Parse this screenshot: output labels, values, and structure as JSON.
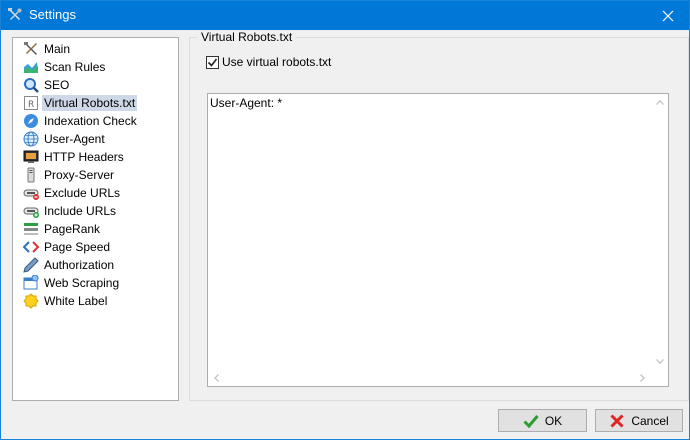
{
  "window": {
    "title": "Settings",
    "icon": "tools-icon",
    "close_icon": "close-icon"
  },
  "nav": {
    "items": [
      {
        "label": "Main",
        "icon": "tools-icon"
      },
      {
        "label": "Scan Rules",
        "icon": "chart-icon"
      },
      {
        "label": "SEO",
        "icon": "magnifier-icon"
      },
      {
        "label": "Virtual Robots.txt",
        "icon": "robots-icon",
        "selected": true
      },
      {
        "label": "Indexation Check",
        "icon": "compass-icon"
      },
      {
        "label": "User-Agent",
        "icon": "globe-icon"
      },
      {
        "label": "HTTP Headers",
        "icon": "monitor-icon"
      },
      {
        "label": "Proxy-Server",
        "icon": "proxy-icon"
      },
      {
        "label": "Exclude URLs",
        "icon": "link-remove-icon"
      },
      {
        "label": "Include URLs",
        "icon": "link-add-icon"
      },
      {
        "label": "PageRank",
        "icon": "list-icon"
      },
      {
        "label": "Page Speed",
        "icon": "code-icon"
      },
      {
        "label": "Authorization",
        "icon": "pen-icon"
      },
      {
        "label": "Web Scraping",
        "icon": "scraping-icon"
      },
      {
        "label": "White Label",
        "icon": "badge-icon"
      }
    ]
  },
  "panel": {
    "group_title": "Virtual Robots.txt",
    "checkbox_label": "Use virtual robots.txt",
    "checkbox_checked": true,
    "editor_text": "User-Agent: *"
  },
  "buttons": {
    "ok_label": "OK",
    "cancel_label": "Cancel"
  },
  "colors": {
    "titlebar": "#0078d7",
    "selection": "#cfd8e6",
    "ok_check": "#2e9e2e",
    "cancel_x": "#e02424"
  }
}
